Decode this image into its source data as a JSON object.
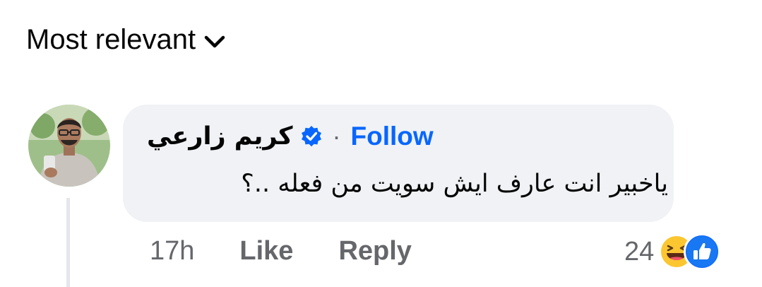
{
  "sort": {
    "label": "Most relevant",
    "icon": "chevron-down-icon"
  },
  "comment": {
    "author": "كريم زارعي",
    "verified_icon": "verified-badge-icon",
    "separator": "·",
    "follow_label": "Follow",
    "text": "ياخبير انت عارف ايش سويت من فعله ..؟",
    "time": "17h",
    "like_label": "Like",
    "reply_label": "Reply",
    "reaction_count": "24",
    "reactions": [
      "laughing-emoji-icon",
      "like-reaction-icon"
    ]
  },
  "colors": {
    "accent": "#0866ff",
    "bubble": "#f0f2f5",
    "secondary_text": "#65676b",
    "primary_text": "#050505"
  }
}
